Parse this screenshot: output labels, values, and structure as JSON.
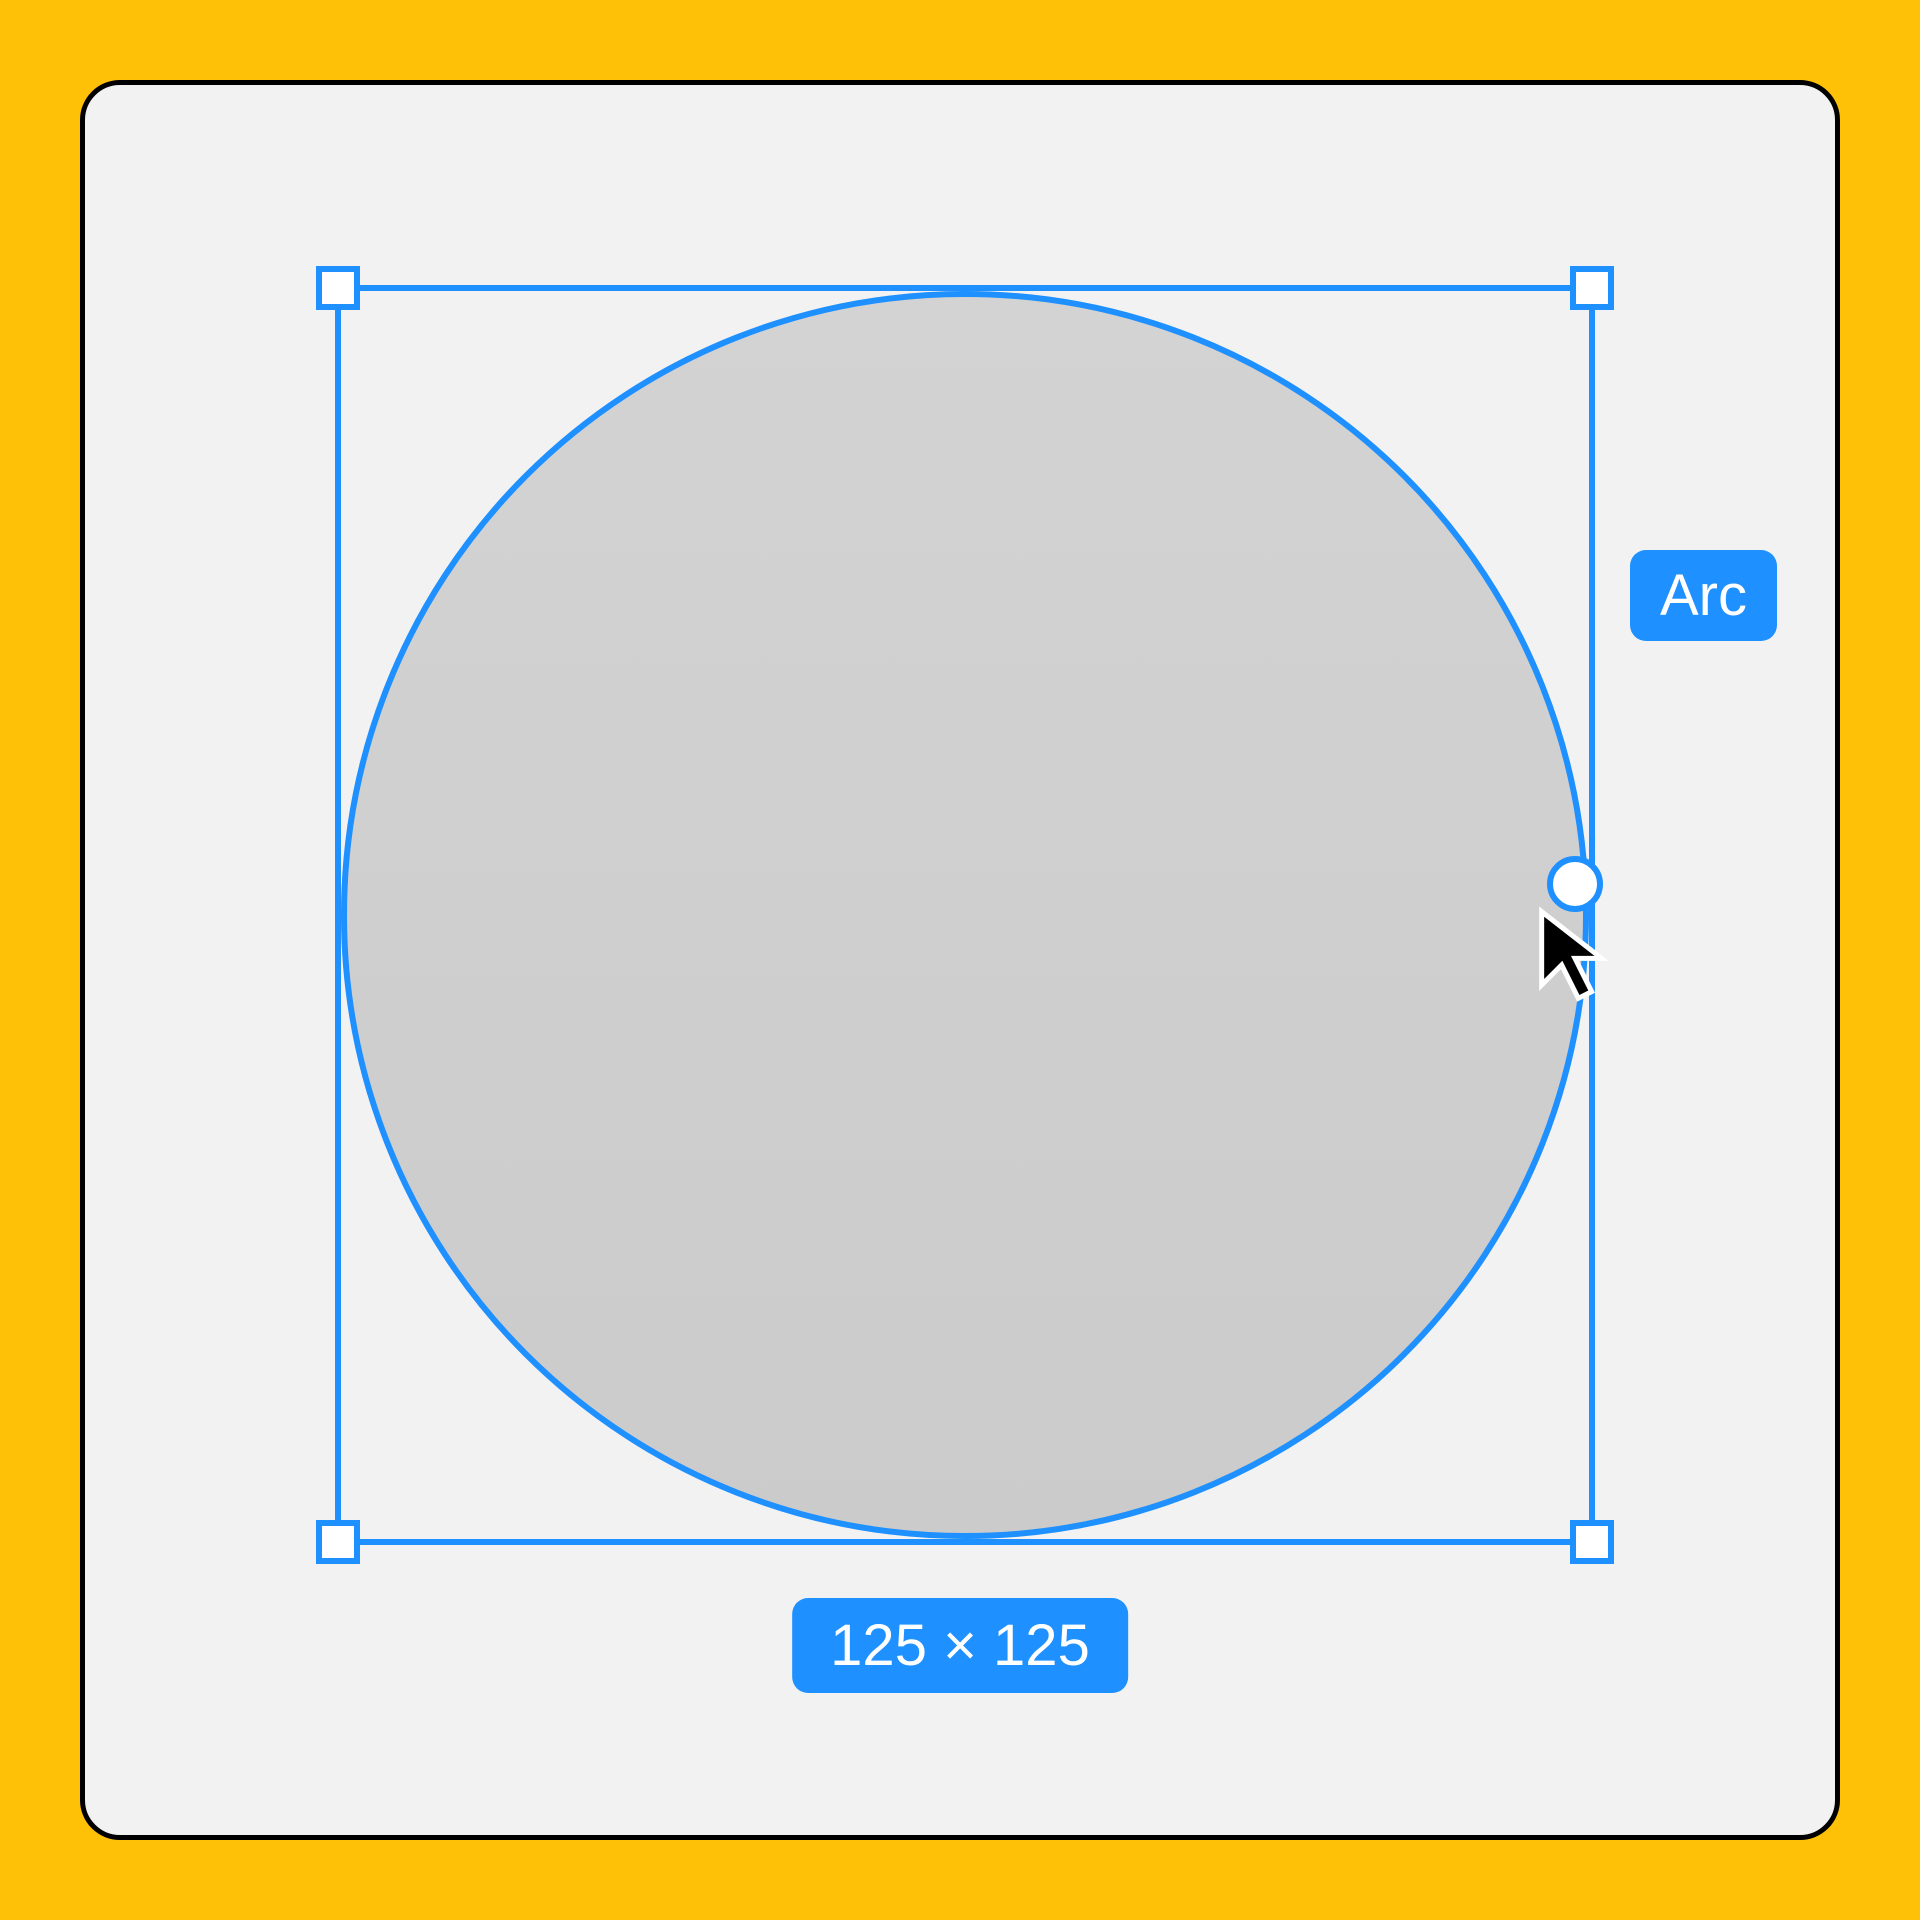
{
  "shape": {
    "name": "circle",
    "fill": "#d1d1d1",
    "stroke": "#1e90ff"
  },
  "arc": {
    "label": "Arc"
  },
  "dimensions": {
    "label": "125 × 125"
  },
  "colors": {
    "selection": "#1e90ff",
    "background": "#ffc107",
    "canvas": "#f2f2f2"
  }
}
